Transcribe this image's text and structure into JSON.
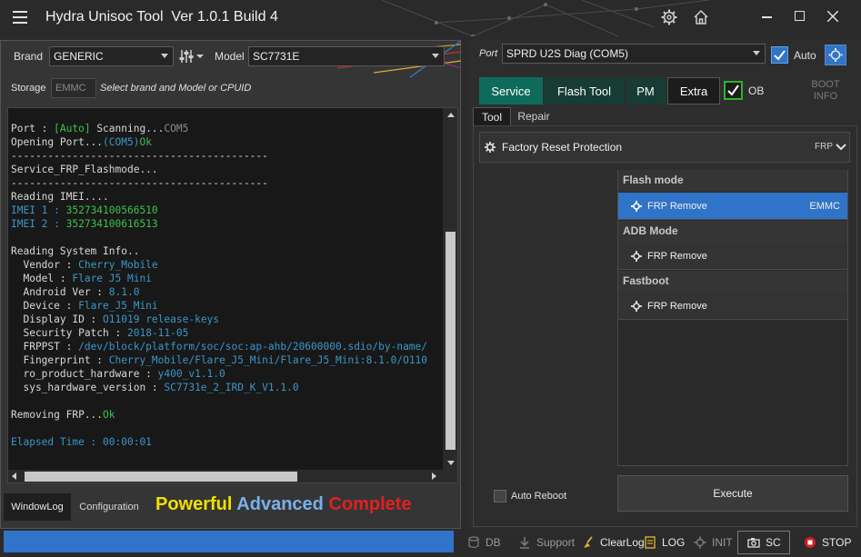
{
  "window": {
    "title": "Hydra Unisoc Tool  Ver 1.0.1 Build 4"
  },
  "left": {
    "brand_label": "Brand",
    "brand_value": "GENERIC",
    "model_label": "Model",
    "model_value": "SC7731E",
    "storage_label": "Storage",
    "storage_value": "EMMC",
    "hint": "Select brand and Model or CPUID",
    "log": [
      [
        [
          "w",
          "Port : "
        ],
        [
          "g",
          "[Auto]"
        ],
        [
          "w",
          " Scanning..."
        ],
        [
          "dg",
          "COM5"
        ]
      ],
      [
        [
          "w",
          "Opening Port..."
        ],
        [
          "b",
          "(COM5)"
        ],
        [
          "g",
          "Ok"
        ]
      ],
      [
        [
          "w",
          "------------------------------------------"
        ]
      ],
      [
        [
          "w",
          "Service_FRP_Flashmode..."
        ]
      ],
      [
        [
          "w",
          "------------------------------------------"
        ]
      ],
      [
        [
          "w",
          "Reading IMEI...."
        ]
      ],
      [
        [
          "b",
          "IMEI 1 : "
        ],
        [
          "g",
          "352734100566510"
        ]
      ],
      [
        [
          "b",
          "IMEI 2 : "
        ],
        [
          "g",
          "352734100616513"
        ]
      ],
      [
        [
          "w",
          ""
        ]
      ],
      [
        [
          "w",
          "Reading System Info.."
        ]
      ],
      [
        [
          "w",
          "  Vendor : "
        ],
        [
          "b",
          "Cherry_Mobile"
        ]
      ],
      [
        [
          "w",
          "  Model : "
        ],
        [
          "b",
          "Flare J5 Mini"
        ]
      ],
      [
        [
          "w",
          "  Android Ver : "
        ],
        [
          "b",
          "8.1.0"
        ]
      ],
      [
        [
          "w",
          "  Device : "
        ],
        [
          "b",
          "Flare_J5_Mini"
        ]
      ],
      [
        [
          "w",
          "  Display ID : "
        ],
        [
          "b",
          "O11019 release-keys"
        ]
      ],
      [
        [
          "w",
          "  Security Patch : "
        ],
        [
          "b",
          "2018-11-05"
        ]
      ],
      [
        [
          "w",
          "  FRPPST : "
        ],
        [
          "b",
          "/dev/block/platform/soc/soc:ap-ahb/20600000.sdio/by-name/"
        ]
      ],
      [
        [
          "w",
          "  Fingerprint : "
        ],
        [
          "b",
          "Cherry_Mobile/Flare_J5_Mini/Flare_J5_Mini:8.1.0/O110"
        ]
      ],
      [
        [
          "w",
          "  ro_product_hardware : "
        ],
        [
          "b",
          "y400_v1.1.0"
        ]
      ],
      [
        [
          "w",
          "  sys_hardware_version : "
        ],
        [
          "b",
          "SC7731e_2_IRD_K_V1.1.0"
        ]
      ],
      [
        [
          "w",
          ""
        ]
      ],
      [
        [
          "w",
          "Removing FRP..."
        ],
        [
          "g",
          "Ok"
        ]
      ],
      [
        [
          "w",
          ""
        ]
      ],
      [
        [
          "b",
          "Elapsed Time : 00:00:01"
        ]
      ]
    ],
    "tabs": [
      "WindowLog",
      "Configuration"
    ],
    "slogan": {
      "w1": "Powerful",
      "w2": "Advanced",
      "w3": "Complete"
    }
  },
  "right": {
    "port_label": "Port",
    "port_value": "SPRD U2S Diag (COM5)",
    "auto_label": "Auto",
    "mode_tabs": [
      "Service",
      "Flash Tool",
      "PM",
      "Extra"
    ],
    "ob_label": "OB",
    "boot_info": [
      "BOOT",
      "INFO"
    ],
    "sub_tabs": [
      "Tool",
      "Repair"
    ],
    "frp_header": "Factory Reset Protection",
    "frp_short": "FRP",
    "sections": [
      {
        "title": "Flash mode",
        "item": "FRP Remove",
        "badge": "EMMC"
      },
      {
        "title": "ADB Mode",
        "item": "FRP Remove",
        "badge": ""
      },
      {
        "title": "Fastboot",
        "item": "FRP Remove",
        "badge": ""
      }
    ],
    "auto_reboot": "Auto Reboot",
    "execute": "Execute"
  },
  "footer": {
    "progress": 1.0,
    "buttons": [
      "DB",
      "Support",
      "ClearLog",
      "LOG",
      "INIT",
      "SC",
      "STOP"
    ]
  },
  "colors": {
    "accent": "#2f74c8",
    "service_tab": "#0e6b5c",
    "checkbox": "#2f74c8",
    "ob_check": "#2bb52b"
  }
}
